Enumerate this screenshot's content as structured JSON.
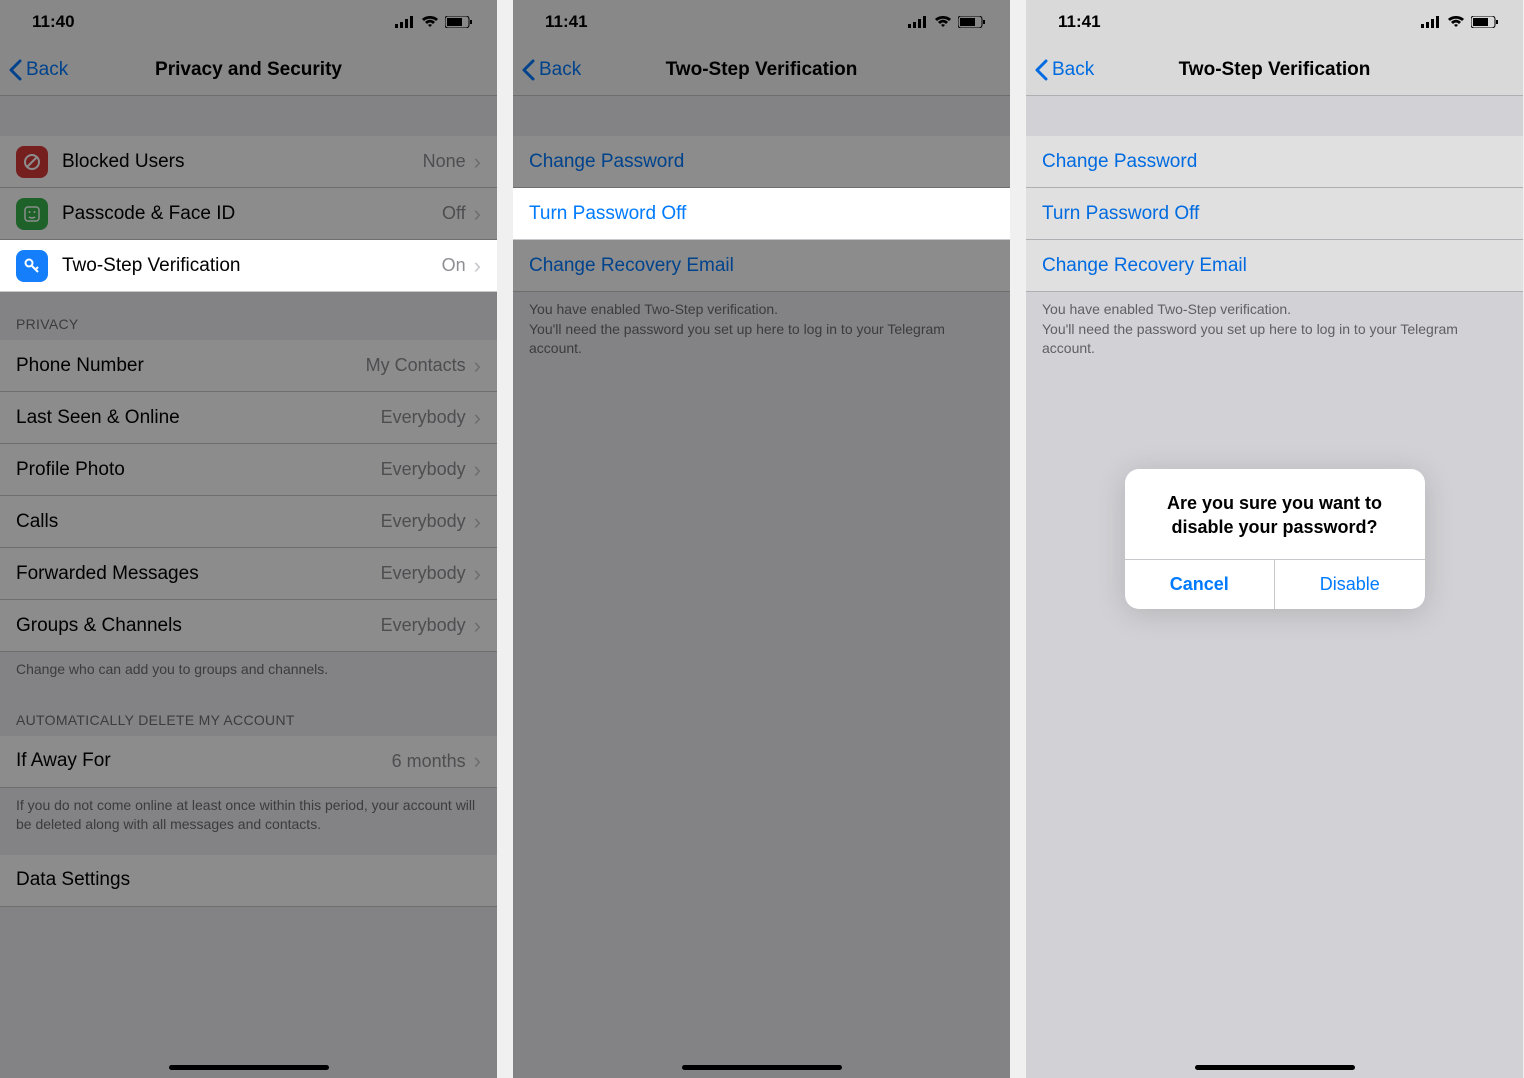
{
  "screen1": {
    "time": "11:40",
    "back": "Back",
    "title": "Privacy and Security",
    "security": {
      "blocked": {
        "label": "Blocked Users",
        "value": "None"
      },
      "passcode": {
        "label": "Passcode & Face ID",
        "value": "Off"
      },
      "twostep": {
        "label": "Two-Step Verification",
        "value": "On"
      }
    },
    "privacy_header": "Privacy",
    "privacy": {
      "phone": {
        "label": "Phone Number",
        "value": "My Contacts"
      },
      "lastseen": {
        "label": "Last Seen & Online",
        "value": "Everybody"
      },
      "profilephoto": {
        "label": "Profile Photo",
        "value": "Everybody"
      },
      "calls": {
        "label": "Calls",
        "value": "Everybody"
      },
      "forwarded": {
        "label": "Forwarded Messages",
        "value": "Everybody"
      },
      "groups": {
        "label": "Groups & Channels",
        "value": "Everybody"
      }
    },
    "privacy_footer": "Change who can add you to groups and channels.",
    "delete_header": "Automatically Delete My Account",
    "ifaway": {
      "label": "If Away For",
      "value": "6 months"
    },
    "delete_footer": "If you do not come online at least once within this period, your account will be deleted along with all messages and contacts.",
    "datasettings": "Data Settings"
  },
  "screen2": {
    "time": "11:41",
    "back": "Back",
    "title": "Two-Step Verification",
    "items": {
      "change_pw": "Change Password",
      "turn_off": "Turn Password Off",
      "recovery": "Change Recovery Email"
    },
    "footer": "You have enabled Two-Step verification.\nYou'll need the password you set up here to log in to your Telegram account."
  },
  "screen3": {
    "time": "11:41",
    "back": "Back",
    "title": "Two-Step Verification",
    "items": {
      "change_pw": "Change Password",
      "turn_off": "Turn Password Off",
      "recovery": "Change Recovery Email"
    },
    "footer": "You have enabled Two-Step verification.\nYou'll need the password you set up here to log in to your Telegram account.",
    "alert": {
      "title": "Are you sure you want to disable your password?",
      "cancel": "Cancel",
      "confirm": "Disable"
    }
  },
  "icons": {
    "blocked_color": "#d73a3a",
    "passcode_color": "#37b24d",
    "twostep_color": "#147efb"
  }
}
